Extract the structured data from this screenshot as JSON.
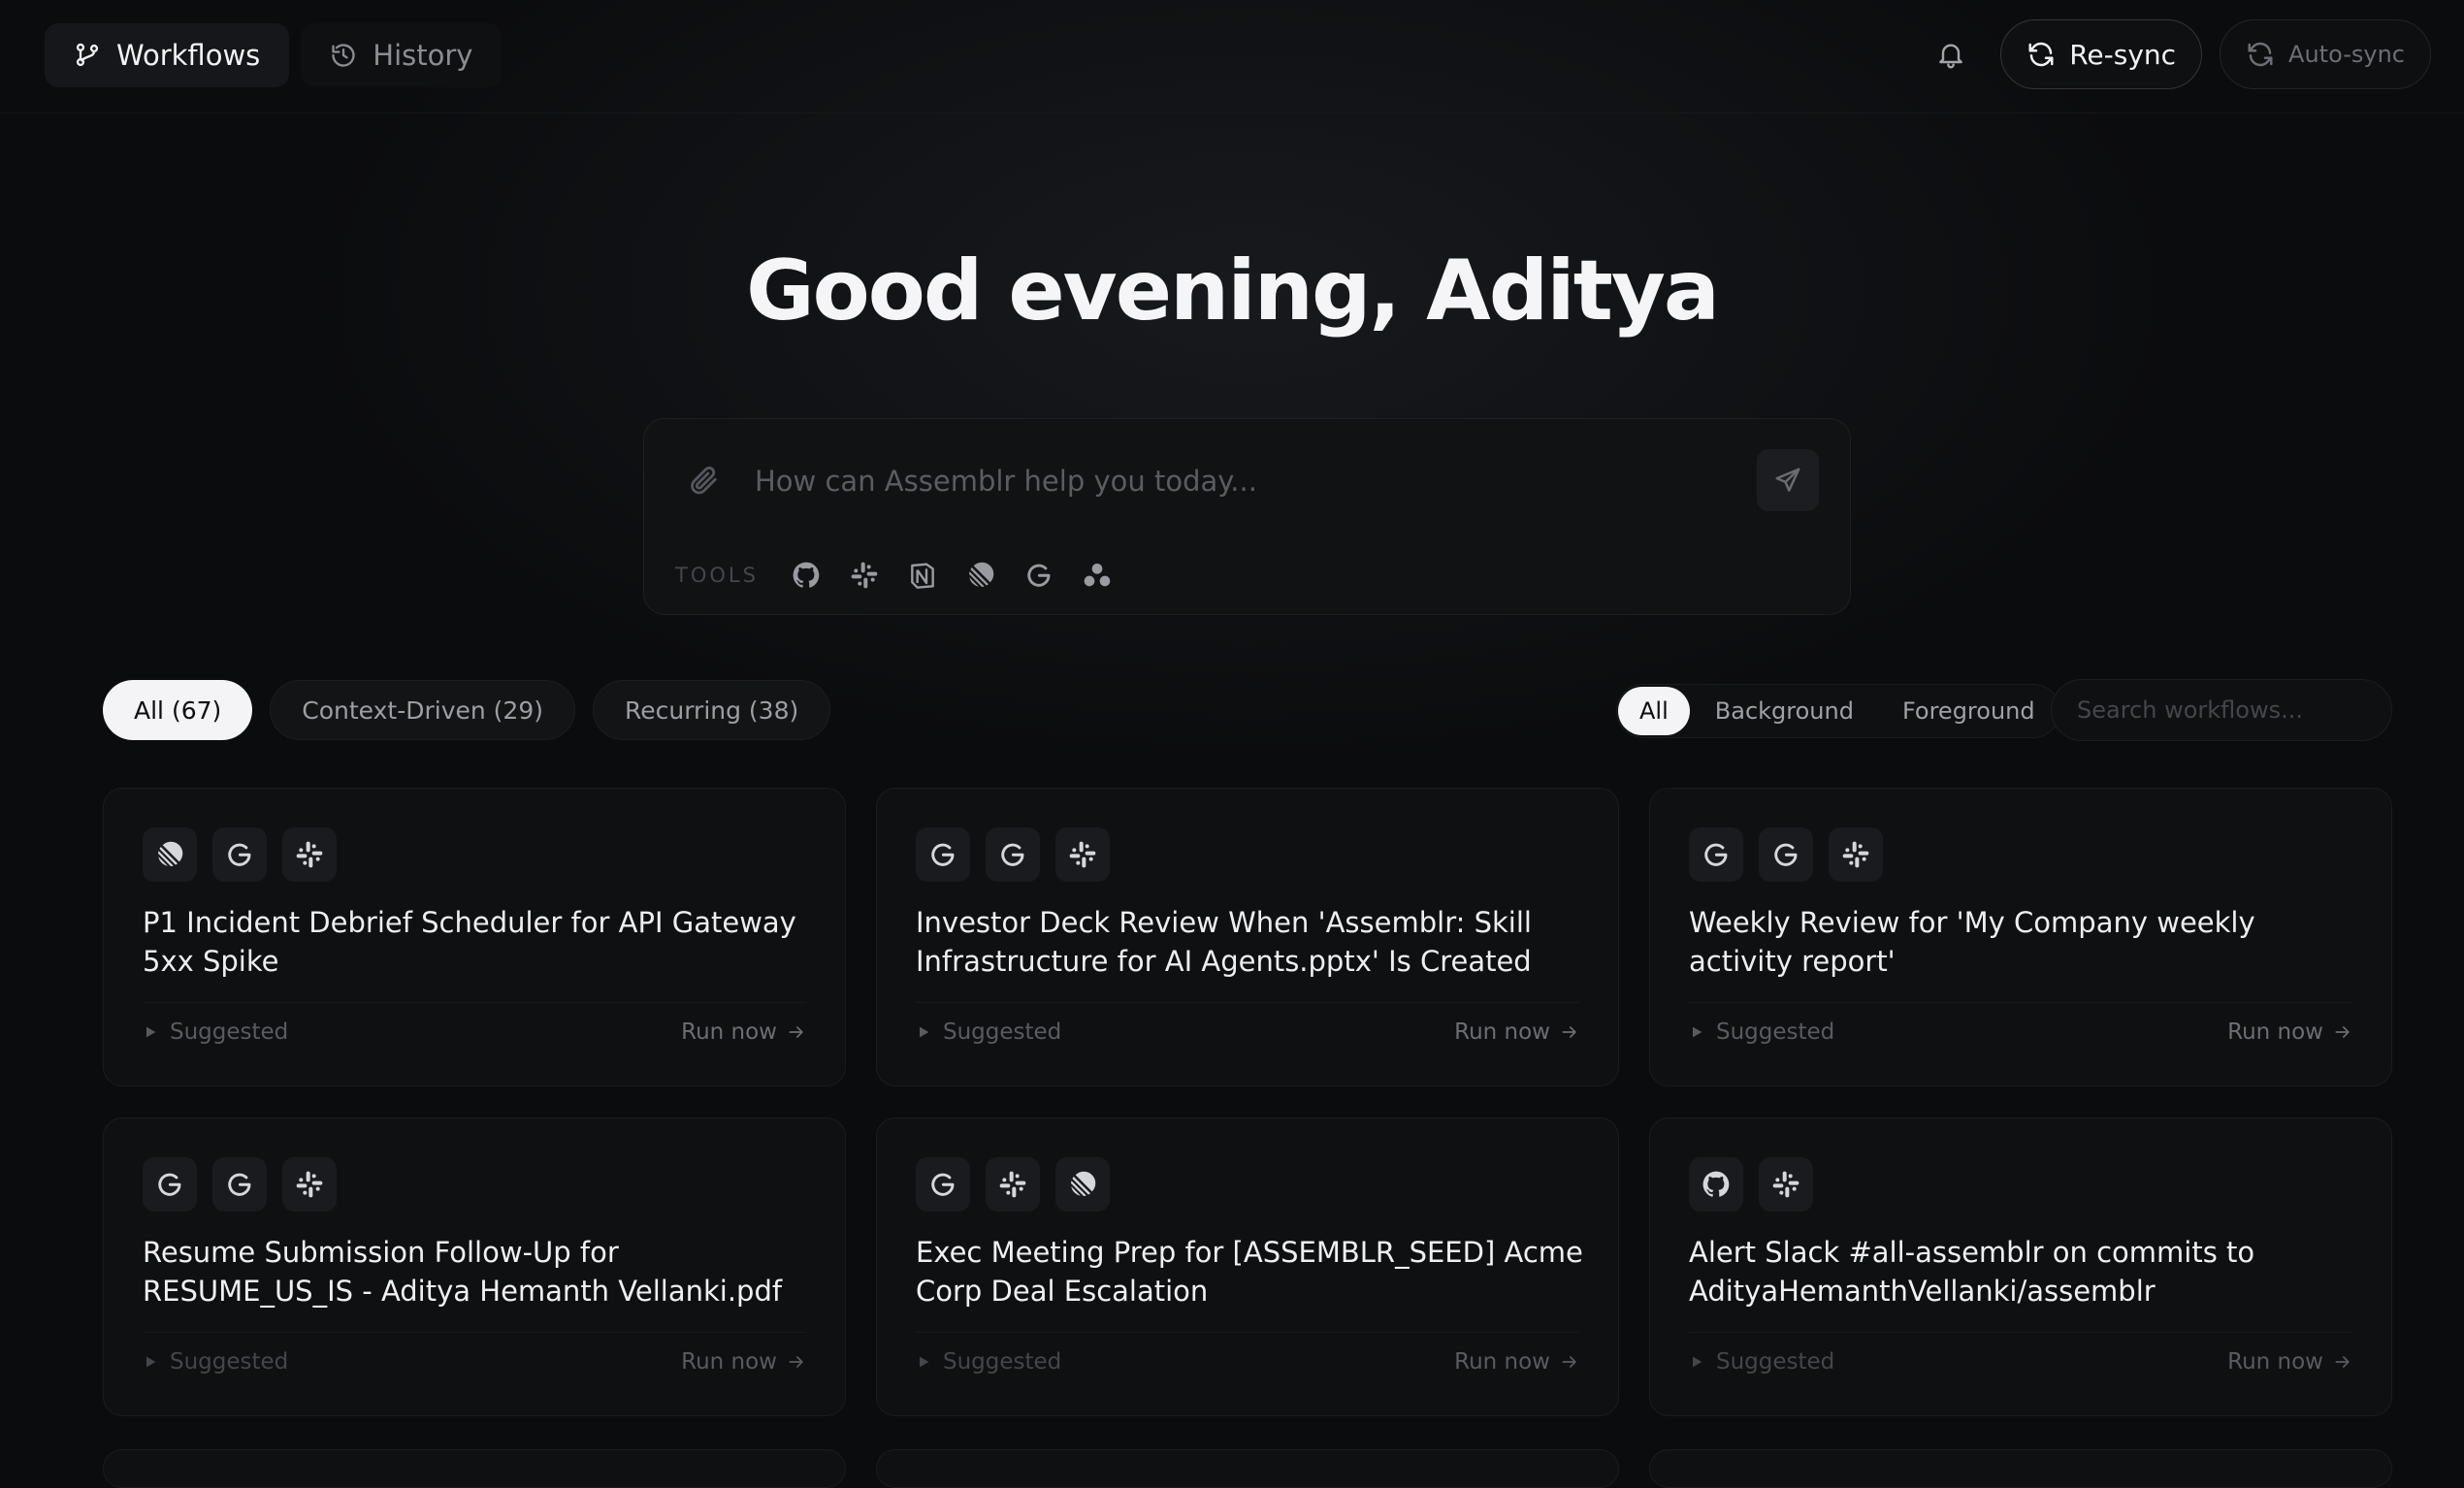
{
  "topbar": {
    "tabs": [
      {
        "label": "Workflows",
        "icon": "git-branch-icon",
        "active": true
      },
      {
        "label": "History",
        "icon": "history-icon",
        "active": false
      }
    ],
    "resync_label": "Re-sync",
    "autosync_label": "Auto-sync"
  },
  "hero": {
    "greeting": "Good evening, Aditya"
  },
  "composer": {
    "placeholder": "How can Assemblr help you today...",
    "tools_label": "TOOLS",
    "tools": [
      "github-icon",
      "slack-icon",
      "notion-icon",
      "linear-icon",
      "google-icon",
      "asana-icon"
    ]
  },
  "filters": {
    "categories": [
      {
        "label": "All (67)",
        "active": true
      },
      {
        "label": "Context-Driven (29)",
        "active": false
      },
      {
        "label": "Recurring (38)",
        "active": false
      }
    ],
    "modes": [
      {
        "label": "All",
        "active": true
      },
      {
        "label": "Background",
        "active": false
      },
      {
        "label": "Foreground",
        "active": false
      }
    ],
    "search_placeholder": "Search workflows..."
  },
  "cards": [
    {
      "icons": [
        "linear-icon",
        "google-icon",
        "slack-icon"
      ],
      "title": "P1 Incident Debrief Scheduler for API Gateway 5xx Spike",
      "status": "Suggested",
      "action": "Run now"
    },
    {
      "icons": [
        "google-icon",
        "google-icon",
        "slack-icon"
      ],
      "title": "Investor Deck Review When 'Assemblr: Skill Infrastructure for AI Agents.pptx' Is Created",
      "status": "Suggested",
      "action": "Run now"
    },
    {
      "icons": [
        "google-icon",
        "google-icon",
        "slack-icon"
      ],
      "title": "Weekly Review for 'My Company weekly activity report'",
      "status": "Suggested",
      "action": "Run now"
    },
    {
      "icons": [
        "google-icon",
        "google-icon",
        "slack-icon"
      ],
      "title": "Resume Submission Follow-Up for RESUME_US_IS - Aditya Hemanth Vellanki.pdf",
      "status": "Suggested",
      "action": "Run now"
    },
    {
      "icons": [
        "google-icon",
        "slack-icon",
        "linear-icon"
      ],
      "title": "Exec Meeting Prep for [ASSEMBLR_SEED] Acme Corp Deal Escalation",
      "status": "Suggested",
      "action": "Run now"
    },
    {
      "icons": [
        "github-icon",
        "slack-icon"
      ],
      "title": "Alert Slack #all-assemblr on commits to AdityaHemanthVellanki/assemblr",
      "status": "Suggested",
      "action": "Run now"
    }
  ]
}
